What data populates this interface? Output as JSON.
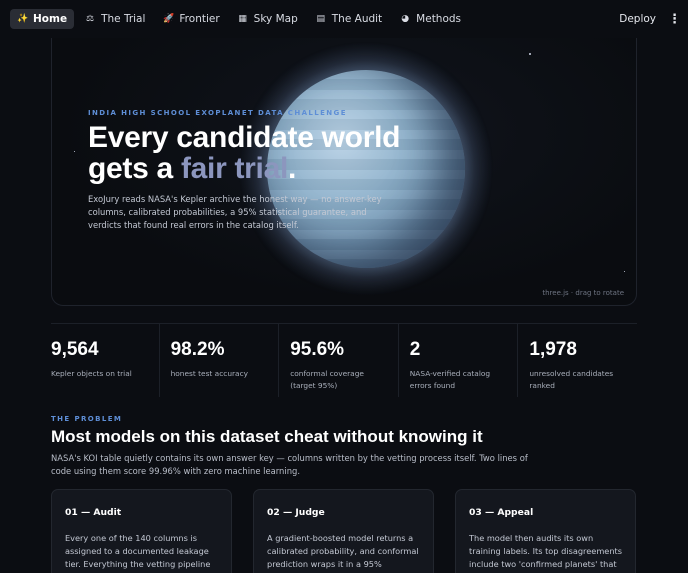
{
  "nav": {
    "items": [
      {
        "label": "Home",
        "icon": "sparkle-icon",
        "glyph": "✨",
        "active": true
      },
      {
        "label": "The Trial",
        "icon": "gavel-icon",
        "glyph": "⚖",
        "active": false
      },
      {
        "label": "Frontier",
        "icon": "rocket-icon",
        "glyph": "🚀",
        "active": false
      },
      {
        "label": "Sky Map",
        "icon": "chart-icon",
        "glyph": "▦",
        "active": false
      },
      {
        "label": "The Audit",
        "icon": "clipboard-icon",
        "glyph": "▤",
        "active": false
      },
      {
        "label": "Methods",
        "icon": "brain-icon",
        "glyph": "◕",
        "active": false
      }
    ],
    "deploy_label": "Deploy",
    "menu_glyph": "⋮"
  },
  "hero": {
    "eyebrow": "INDIA HIGH SCHOOL EXOPLANET DATA CHALLENGE",
    "title_line1": "Every candidate world",
    "title_line2_prefix": "gets a ",
    "title_accent": "fair trial",
    "title_suffix": ".",
    "description": "ExoJury reads NASA's Kepler archive the honest way — no answer-key columns, calibrated probabilities, a 95% statistical guarantee, and verdicts that found real errors in the catalog itself.",
    "caption": "three.js · drag to rotate"
  },
  "stats": [
    {
      "value": "9,564",
      "label": "Kepler objects on trial"
    },
    {
      "value": "98.2%",
      "label": "honest test accuracy"
    },
    {
      "value": "95.6%",
      "label": "conformal coverage (target 95%)"
    },
    {
      "value": "2",
      "label": "NASA-verified catalog errors found"
    },
    {
      "value": "1,978",
      "label": "unresolved candidates ranked"
    }
  ],
  "problem": {
    "eyebrow": "THE PROBLEM",
    "title": "Most models on this dataset cheat without knowing it",
    "description": "NASA's KOI table quietly contains its own answer key — columns written by the vetting process itself. Two lines of code using them score 99.96% with zero machine learning.",
    "cards": [
      {
        "title": "01 — Audit",
        "body": "Every one of the 140 columns is assigned to a documented leakage tier. Everything the vetting pipeline"
      },
      {
        "title": "02 — Judge",
        "body": "A gradient-boosted model returns a calibrated probability, and conformal prediction wraps it in a 95%"
      },
      {
        "title": "03 — Appeal",
        "body": "The model then audits its own training labels. Its top disagreements include two 'confirmed planets' that"
      }
    ]
  },
  "colors": {
    "background": "#0b0d12",
    "accent_blue": "#5e8ed6",
    "title_accent": "#8c96be"
  }
}
